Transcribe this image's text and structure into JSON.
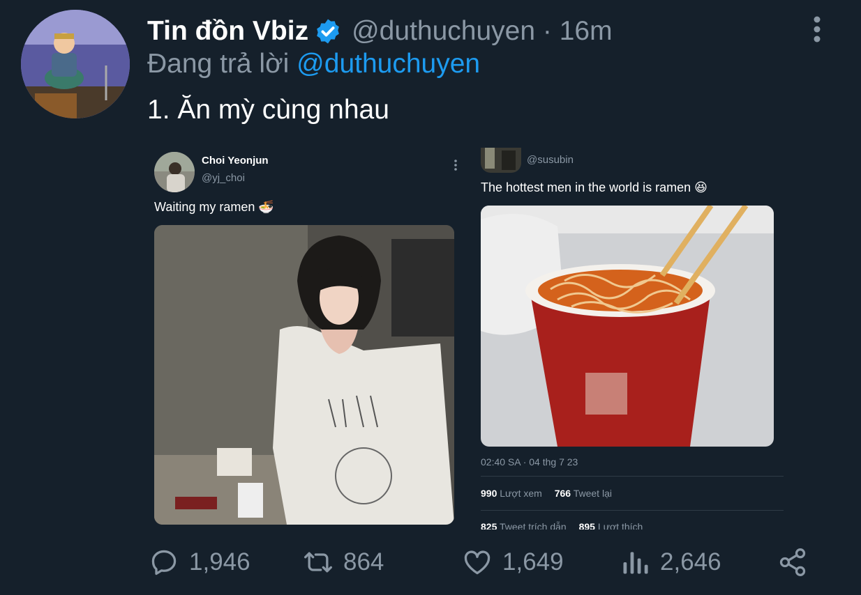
{
  "tweet": {
    "display_name": "Tin đồn Vbiz",
    "handle_time": "@duthuchuyen · 16m",
    "reply_prefix": "Đang trả lời",
    "reply_mention": "@duthuchuyen",
    "text": "1. Ăn mỳ cùng nhau"
  },
  "embed_left": {
    "name": "Choi Yeonjun",
    "handle": "@yj_choi",
    "text": "Waiting my ramen 🍜"
  },
  "embed_right": {
    "handle": "@susubin",
    "text": "The hottest men in the world is ramen 😆",
    "timestamp": "02:40 SA · 04 thg 7 23",
    "views_count": "990",
    "views_label": "Lượt xem",
    "retweets_count": "766",
    "retweets_label": "Tweet lại",
    "quotes_count": "825",
    "quotes_label": "Tweet trích dẫn",
    "likes_count": "895",
    "likes_label": "Lượt thích"
  },
  "actions": {
    "reply_count": "1,946",
    "retweet_count": "864",
    "like_count": "1,649",
    "views_count": "2,646"
  },
  "colors": {
    "background": "#15202b",
    "accent": "#1d9bf0",
    "muted": "#8b98a5"
  }
}
